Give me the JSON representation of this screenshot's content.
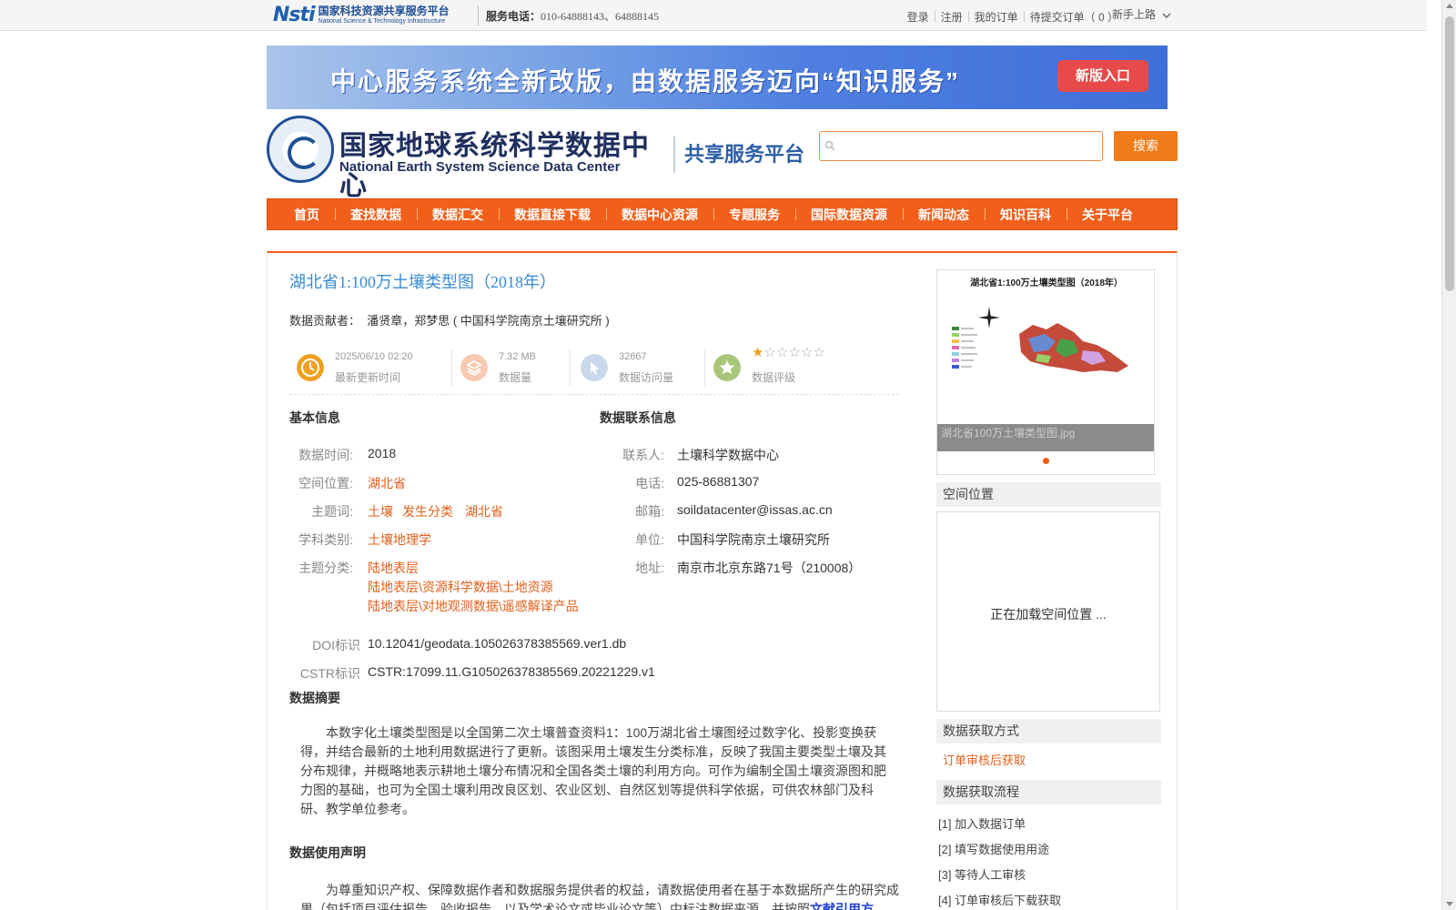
{
  "topbar": {
    "nsti_mark": "Nsti",
    "nsti_cn": "国家科技资源共享服务平台",
    "nsti_en": "National Science & Technology Infrastructure",
    "service_label": "服务电话：",
    "service_numbers": "010-64888143、64888145",
    "links": [
      "登录",
      "注册",
      "我的订单",
      "待提交订单（ 0 ）"
    ],
    "guide": "新手上路"
  },
  "banner": {
    "text": "中心服务系统全新改版，由数据服务迈向“知识服务”",
    "button": "新版入口"
  },
  "header": {
    "logo_cn": "国家地球系统科学数据中心",
    "logo_en": "National Earth System Science Data Center",
    "platform": "共享服务平台",
    "search_placeholder": "",
    "search_button": "搜索"
  },
  "nav": [
    "首页",
    "查找数据",
    "数据汇交",
    "数据直接下载",
    "数据中心资源",
    "专题服务",
    "国际数据资源",
    "新闻动态",
    "知识百科",
    "关于平台"
  ],
  "dataset": {
    "title": "湖北省1:100万土壤类型图（2018年）",
    "contributor_label": "数据贡献者：",
    "contributor": "潘贤章，郑梦思 ( 中国科学院南京土壤研究所 )"
  },
  "stats": {
    "updated_value": "2025/06/10 02:20",
    "updated_label": "最新更新时间",
    "size_value": "7.32 MB",
    "size_label": "数据量",
    "visits_value": "32667",
    "visits_label": "数据访问量",
    "rating_label": "数据评级",
    "rating_stars": 1,
    "rating_max": 6,
    "colors": {
      "clock": "#f0a020",
      "layers": "#f6c9b0",
      "cursor": "#c8d8ea",
      "star": "#a9c77a"
    }
  },
  "basic": {
    "heading": "基本信息",
    "time_label": "数据时间:",
    "time_value": "2018",
    "location_label": "空间位置:",
    "location_value": "湖北省",
    "keywords_label": "主题词:",
    "keywords": [
      "土壤",
      "发生分类",
      "湖北省"
    ],
    "discipline_label": "学科类别:",
    "discipline_value": "土壤地理学",
    "category_label": "主题分类:",
    "categories": [
      "陆地表层",
      "陆地表层\\资源科学数据\\土地资源",
      "陆地表层\\对地观测数据\\遥感解译产品"
    ],
    "doi_label": "DOI标识",
    "doi_value": "10.12041/geodata.105026378385569.ver1.db",
    "cstr_label": "CSTR标识",
    "cstr_value": "CSTR:17099.11.G105026378385569.20221229.v1"
  },
  "contact": {
    "heading": "数据联系信息",
    "person_label": "联系人:",
    "person_value": "土壤科学数据中心",
    "phone_label": "电话:",
    "phone_value": "025-86881307",
    "email_label": "邮箱:",
    "email_value": "soildatacenter@issas.ac.cn",
    "unit_label": "单位:",
    "unit_value": "中国科学院南京土壤研究所",
    "address_label": "地址:",
    "address_value": "南京市北京东路71号（210008）"
  },
  "abstract": {
    "heading": "数据摘要",
    "text": "本数字化土壤类型图是以全国第二次土壤普查资料1：100万湖北省土壤图经过数字化、投影变换获得，并结合最新的土地利用数据进行了更新。该图采用土壤发生分类标准，反映了我国主要类型土壤及其分布规律，并概略地表示耕地土壤分布情况和全国各类土壤的利用方向。可作为编制全国土壤资源图和肥力图的基础，也可为全国土壤利用改良区划、农业区划、自然区划等提供科学依据，可供农林部门及科研、教学单位参考。"
  },
  "usage": {
    "heading": "数据使用声明",
    "text": "为尊重知识产权、保障数据作者和数据服务提供者的权益，请数据使用者在基于本数据所产生的研究成果（包括项目评估报告、验收报告，以及学术论文或毕业论文等）中标注数据来源，并按照",
    "cite_link": "文献引用方"
  },
  "sidebar": {
    "thumb_title": "湖北省1:100万土壤类型图（2018年）",
    "thumb_caption": "湖北省100万土壤类型图.jpg",
    "spatial_heading": "空间位置",
    "map_loading": "正在加载空间位置 ...",
    "acquire_heading": "数据获取方式",
    "acquire_link": "订单审核后获取",
    "flow_heading": "数据获取流程",
    "flow_steps": [
      "[1] 加入数据订单",
      "[2] 填写数据使用用途",
      "[3] 等待人工审核",
      "[4] 订单审核后下载获取"
    ]
  }
}
